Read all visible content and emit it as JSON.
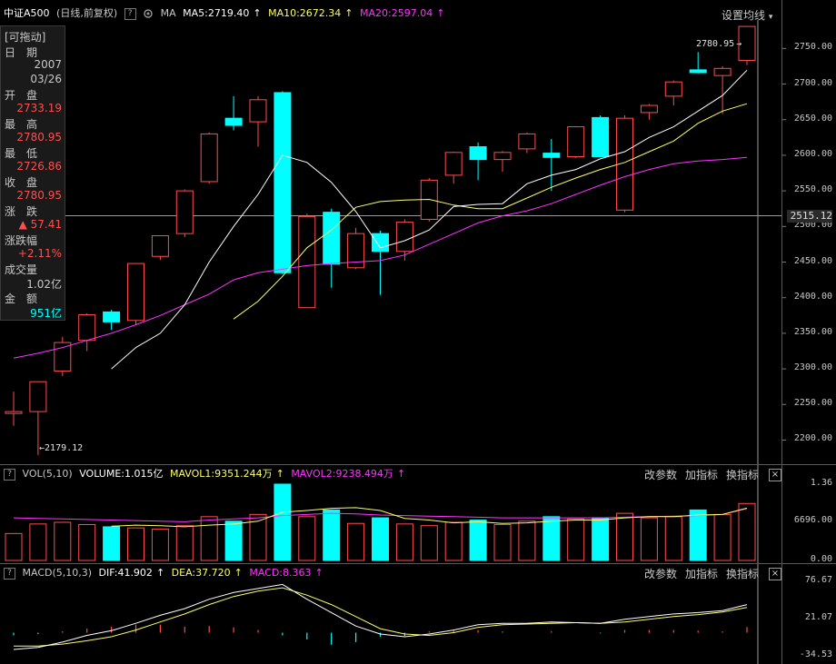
{
  "header": {
    "symbol": "中证A500",
    "period": "(日线,前复权)",
    "help_label": "?",
    "ma_label": "MA",
    "ma5": "MA5:2719.40",
    "ma10": "MA10:2672.34",
    "ma20": "MA20:2597.04",
    "arrow": "↑",
    "settings": "设置均线",
    "settings_arrow": "▾"
  },
  "info_panel": {
    "drag_label": "[可拖动]",
    "date_label": "日　期",
    "year": "2007",
    "date": "03/26",
    "open_label": "开　盘",
    "open": "2733.19",
    "high_label": "最　高",
    "high": "2780.95",
    "low_label": "最　低",
    "low": "2726.86",
    "close_label": "收　盘",
    "close": "2780.95",
    "change_label": "涨　跌",
    "change": "▲ 57.41",
    "pct_label": "涨跌幅",
    "pct": "+2.11%",
    "volume_label": "成交量",
    "volume": "1.02亿",
    "amount_label": "金　额",
    "amount": "951亿"
  },
  "price_axis": {
    "ticks": [
      "2750.00",
      "2700.00",
      "2650.00",
      "2600.00",
      "2550.00",
      "2500.00",
      "2450.00",
      "2400.00",
      "2350.00",
      "2300.00",
      "2250.00",
      "2200.00"
    ],
    "last_price": "2515.12",
    "max_marker": "2780.95",
    "min_marker": "2179.12"
  },
  "vol_panel": {
    "help_label": "?",
    "title": "VOL(5,10)",
    "volume": "VOLUME:1.015亿",
    "mavol1": "MAVOL1:9351.244万",
    "mavol2": "MAVOL2:9238.494万",
    "arrow": "↑",
    "edit_params": "改参数",
    "add_indicator": "加指标",
    "change_indicator": "换指标",
    "close": "×",
    "ticks": [
      "1.36",
      "6696.00",
      "0.00"
    ]
  },
  "macd_panel": {
    "help_label": "?",
    "title": "MACD(5,10,3)",
    "dif": "DIF:41.902",
    "dea": "DEA:37.720",
    "macd": "MACD:8.363",
    "arrow": "↑",
    "edit_params": "改参数",
    "add_indicator": "加指标",
    "change_indicator": "换指标",
    "close": "×",
    "ticks": [
      "76.67",
      "21.07",
      "-34.53"
    ]
  },
  "colors": {
    "up": "#ff4d4d",
    "down": "#00ffff",
    "ma5": "#ffffff",
    "ma10": "#ffff66",
    "ma20": "#ff33ff",
    "text": "#c8c8c8"
  },
  "chart_data": {
    "type": "candlestick",
    "title": "",
    "price_ylim": [
      2170,
      2790
    ],
    "candles": [
      {
        "o": 2240,
        "h": 2268,
        "l": 2220,
        "c": 2240
      },
      {
        "o": 2240,
        "h": 2282,
        "l": 2179.12,
        "c": 2282
      },
      {
        "o": 2297,
        "h": 2345,
        "l": 2290,
        "c": 2337
      },
      {
        "o": 2340,
        "h": 2378,
        "l": 2325,
        "c": 2376
      },
      {
        "o": 2380,
        "h": 2383,
        "l": 2355,
        "c": 2366
      },
      {
        "o": 2368,
        "h": 2448,
        "l": 2362,
        "c": 2448
      },
      {
        "o": 2458,
        "h": 2487,
        "l": 2453,
        "c": 2487
      },
      {
        "o": 2490,
        "h": 2552,
        "l": 2485,
        "c": 2550
      },
      {
        "o": 2563,
        "h": 2632,
        "l": 2560,
        "c": 2630
      },
      {
        "o": 2652,
        "h": 2683,
        "l": 2635,
        "c": 2642
      },
      {
        "o": 2647,
        "h": 2683,
        "l": 2612,
        "c": 2678
      },
      {
        "o": 2688,
        "h": 2690,
        "l": 2433,
        "c": 2435
      },
      {
        "o": 2386,
        "h": 2518,
        "l": 2386,
        "c": 2514
      },
      {
        "o": 2520,
        "h": 2525,
        "l": 2414,
        "c": 2447
      },
      {
        "o": 2442,
        "h": 2498,
        "l": 2440,
        "c": 2490
      },
      {
        "o": 2490,
        "h": 2494,
        "l": 2404,
        "c": 2465
      },
      {
        "o": 2465,
        "h": 2510,
        "l": 2452,
        "c": 2506
      },
      {
        "o": 2510,
        "h": 2568,
        "l": 2507,
        "c": 2565
      },
      {
        "o": 2572,
        "h": 2605,
        "l": 2560,
        "c": 2604
      },
      {
        "o": 2612,
        "h": 2618,
        "l": 2565,
        "c": 2594
      },
      {
        "o": 2594,
        "h": 2606,
        "l": 2577,
        "c": 2604
      },
      {
        "o": 2609,
        "h": 2632,
        "l": 2603,
        "c": 2630
      },
      {
        "o": 2603,
        "h": 2623,
        "l": 2550,
        "c": 2597
      },
      {
        "o": 2598,
        "h": 2641,
        "l": 2596,
        "c": 2640
      },
      {
        "o": 2653,
        "h": 2656,
        "l": 2598,
        "c": 2598
      },
      {
        "o": 2523,
        "h": 2656,
        "l": 2520,
        "c": 2652
      },
      {
        "o": 2660,
        "h": 2672,
        "l": 2650,
        "c": 2670
      },
      {
        "o": 2683,
        "h": 2705,
        "l": 2670,
        "c": 2703
      },
      {
        "o": 2720,
        "h": 2745,
        "l": 2715,
        "c": 2716
      },
      {
        "o": 2712,
        "h": 2725,
        "l": 2658,
        "c": 2722
      },
      {
        "o": 2733.19,
        "h": 2780.95,
        "l": 2726.86,
        "c": 2780.95
      }
    ],
    "ma5": [
      null,
      null,
      null,
      null,
      2300,
      2330,
      2350,
      2390,
      2450,
      2500,
      2545,
      2600,
      2590,
      2562,
      2521,
      2470,
      2480,
      2495,
      2528,
      2531,
      2532,
      2560,
      2572,
      2580,
      2595,
      2605,
      2625,
      2640,
      2662,
      2684,
      2719.4
    ],
    "ma10": [
      null,
      null,
      null,
      null,
      null,
      null,
      null,
      null,
      null,
      2370,
      2395,
      2430,
      2470,
      2495,
      2527,
      2535,
      2537,
      2538,
      2530,
      2525,
      2525,
      2540,
      2555,
      2568,
      2580,
      2590,
      2605,
      2620,
      2645,
      2662,
      2672.34
    ],
    "ma20": [
      2315,
      2322,
      2330,
      2340,
      2350,
      2362,
      2375,
      2390,
      2405,
      2425,
      2435,
      2440,
      2445,
      2448,
      2450,
      2452,
      2460,
      2475,
      2490,
      2505,
      2515,
      2522,
      2532,
      2545,
      2558,
      2570,
      2580,
      2588,
      2592,
      2594,
      2597.04
    ],
    "volume_ylim": [
      0,
      1.36
    ],
    "volume": [
      0.48,
      0.65,
      0.68,
      0.64,
      0.6,
      0.58,
      0.56,
      0.62,
      0.78,
      0.7,
      0.82,
      1.36,
      0.78,
      0.9,
      0.66,
      0.76,
      0.65,
      0.62,
      0.68,
      0.72,
      0.64,
      0.7,
      0.78,
      0.74,
      0.76,
      0.84,
      0.76,
      0.78,
      0.9,
      0.82,
      1.015
    ],
    "mavol1": [
      null,
      null,
      null,
      null,
      0.61,
      0.63,
      0.62,
      0.6,
      0.63,
      0.65,
      0.7,
      0.86,
      0.89,
      0.93,
      0.94,
      0.89,
      0.75,
      0.72,
      0.67,
      0.69,
      0.66,
      0.67,
      0.7,
      0.72,
      0.72,
      0.76,
      0.78,
      0.78,
      0.81,
      0.82,
      0.935
    ],
    "mavol2": [
      0.76,
      0.75,
      0.74,
      0.73,
      0.72,
      0.71,
      0.7,
      0.69,
      0.72,
      0.74,
      0.76,
      0.8,
      0.82,
      0.84,
      0.83,
      0.81,
      0.8,
      0.79,
      0.78,
      0.77,
      0.76,
      0.76,
      0.76,
      0.76,
      0.76,
      0.77,
      0.78,
      0.79,
      0.8,
      0.82,
      0.924
    ],
    "macd_ylim": [
      -34.53,
      76.67
    ],
    "dif": [
      -25,
      -22,
      -14,
      -4,
      3,
      14,
      26,
      36,
      50,
      60,
      66,
      72,
      50,
      30,
      10,
      -2,
      -6,
      -2,
      4,
      12,
      14,
      14,
      16,
      15,
      14,
      20,
      24,
      28,
      30,
      33,
      41.9
    ],
    "dea": [
      -20,
      -20,
      -17,
      -12,
      -6,
      4,
      16,
      28,
      42,
      54,
      62,
      67,
      56,
      42,
      24,
      6,
      -2,
      -4,
      0,
      8,
      12,
      13,
      14,
      15,
      14,
      16,
      20,
      24,
      27,
      31,
      37.72
    ],
    "macd_hist": [
      -4,
      -2,
      2,
      6,
      9,
      12,
      12,
      9,
      10,
      8,
      4,
      -4,
      -10,
      -18,
      -14,
      -6,
      -5,
      2,
      4,
      4,
      2,
      0,
      2,
      0,
      -1,
      4,
      4,
      4,
      3,
      2,
      8.363
    ]
  }
}
